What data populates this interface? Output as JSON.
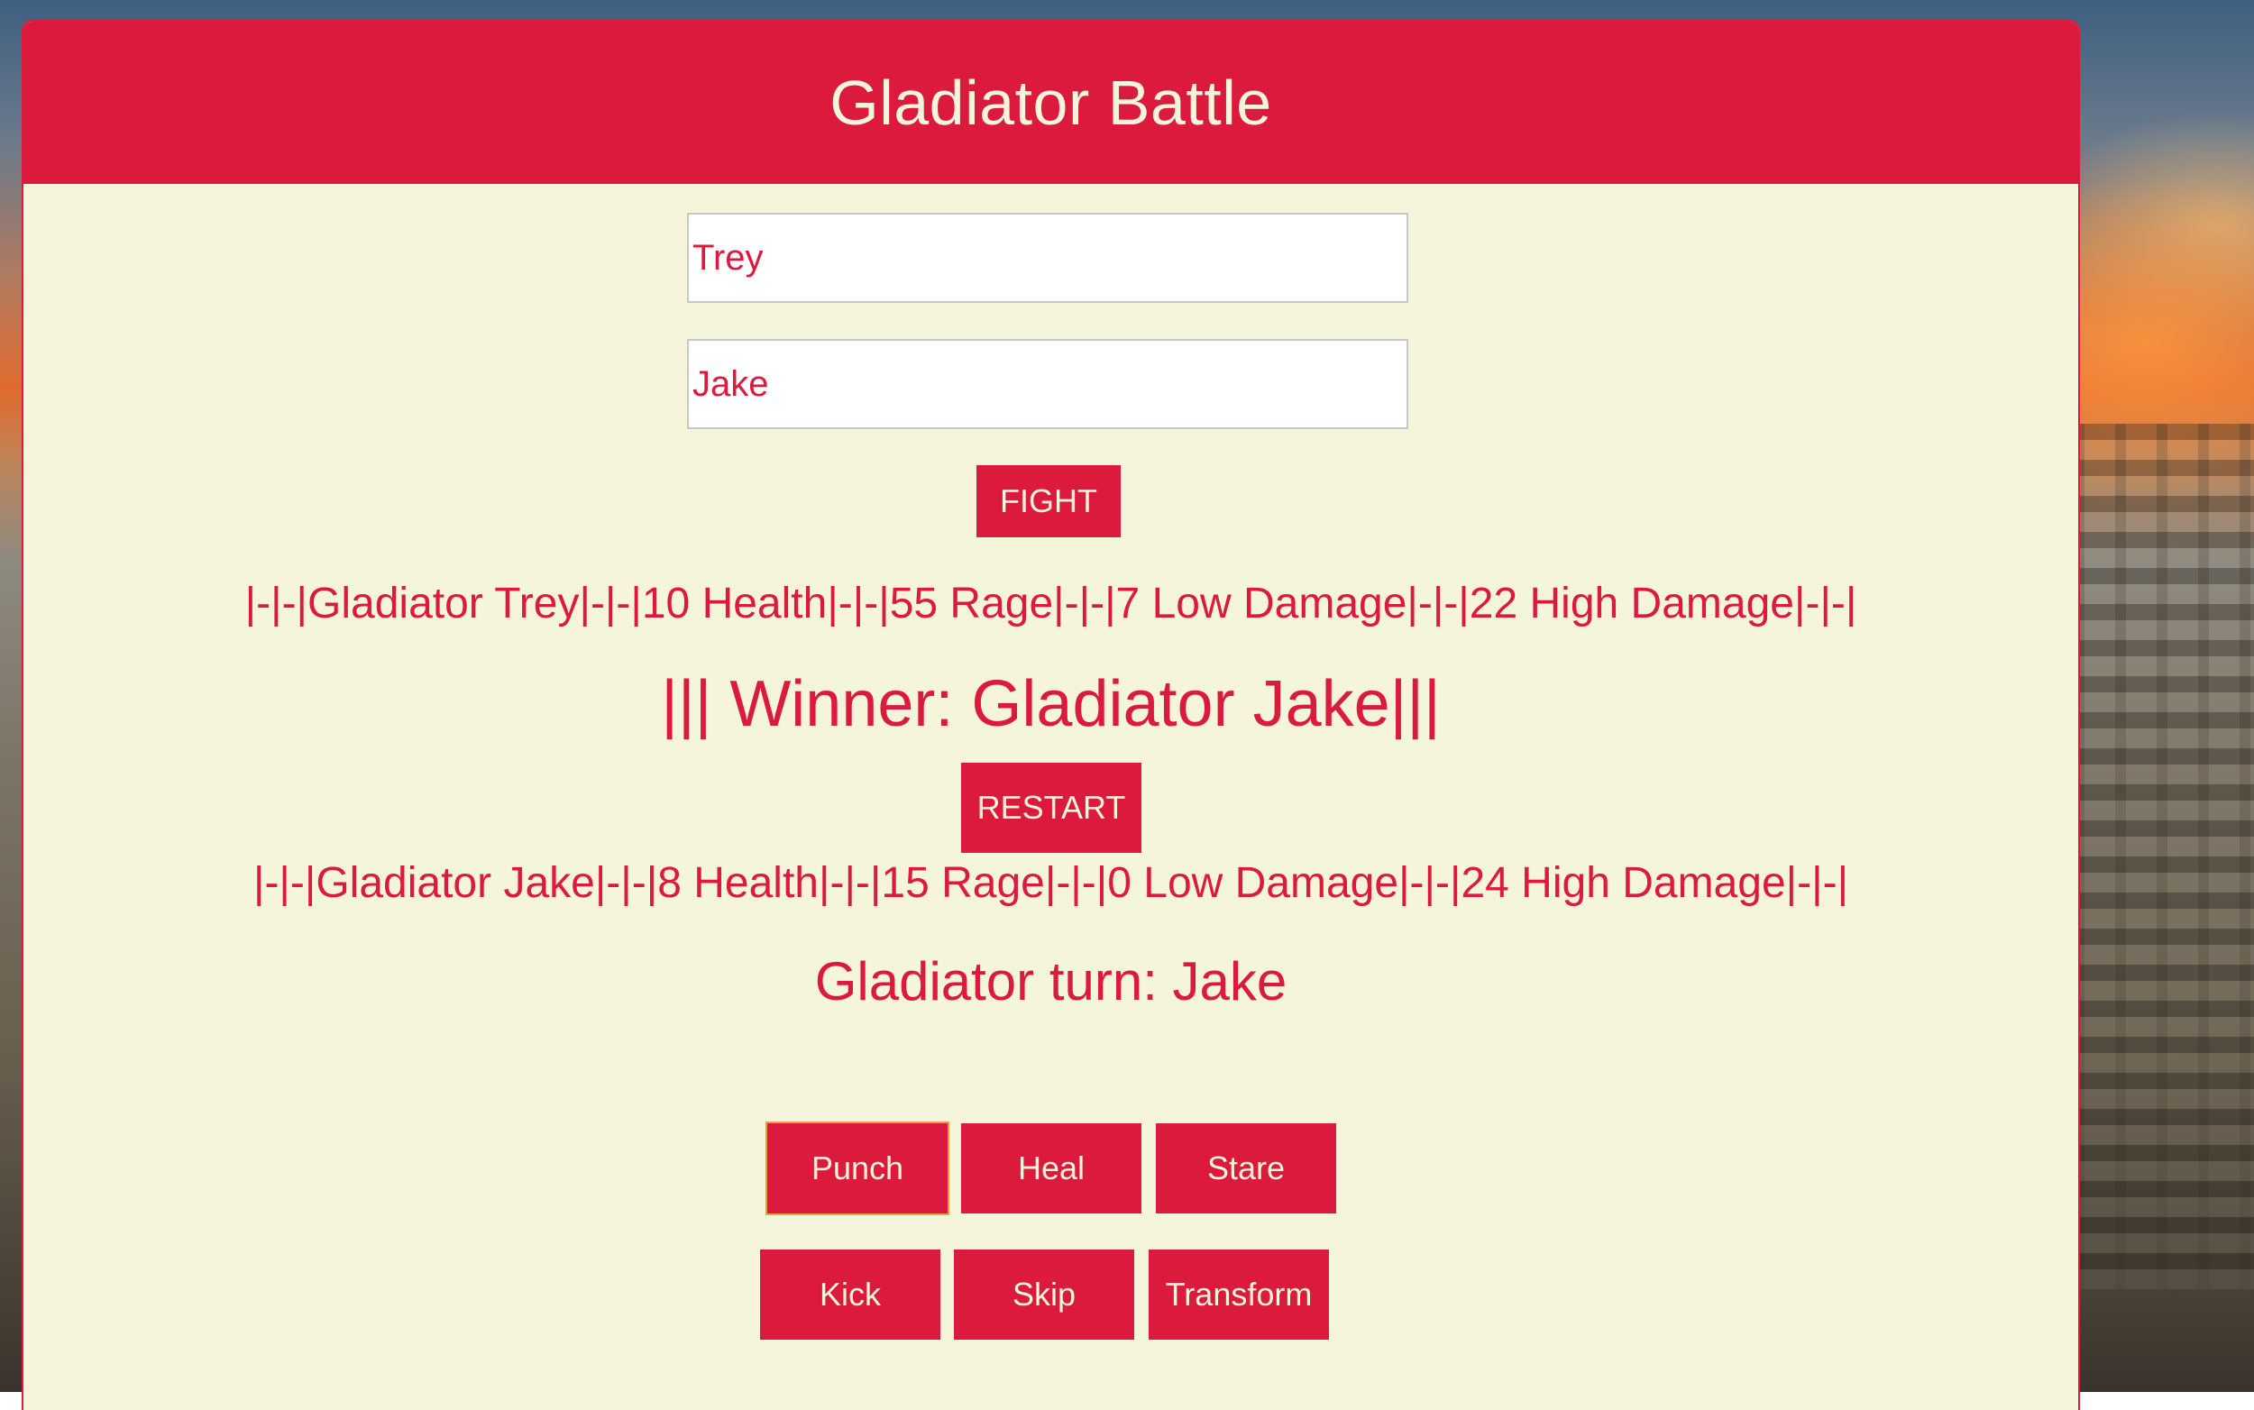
{
  "header": {
    "title": "Gladiator Battle"
  },
  "inputs": {
    "gladiator1": "Trey",
    "gladiator2": "Jake"
  },
  "buttons": {
    "fight": "FIGHT",
    "restart": "RESTART"
  },
  "stats": {
    "gladiator1": "|-|-|Gladiator Trey|-|-|10 Health|-|-|55 Rage|-|-|7 Low Damage|-|-|22 High Damage|-|-|",
    "gladiator2": "|-|-|Gladiator Jake|-|-|8 Health|-|-|15 Rage|-|-|0 Low Damage|-|-|24 High Damage|-|-|"
  },
  "winner": "||| Winner: Gladiator Jake|||",
  "turn": "Gladiator turn: Jake",
  "actions": {
    "punch": "Punch",
    "heal": "Heal",
    "stare": "Stare",
    "kick": "Kick",
    "skip": "Skip",
    "transform": "Transform"
  },
  "colors": {
    "accent": "#dc1a3e",
    "panel_background": "#f5f5dc",
    "button_text": "#f5f5dc"
  }
}
